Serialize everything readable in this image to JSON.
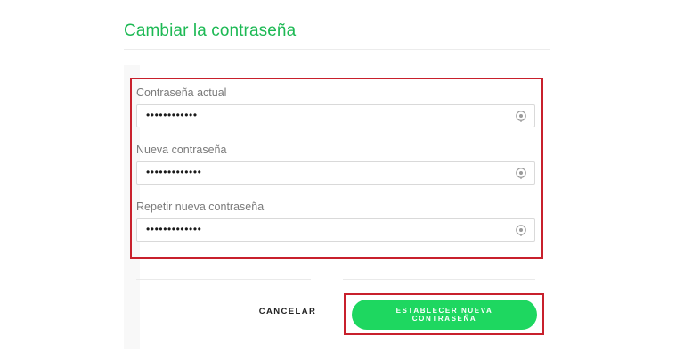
{
  "page": {
    "title": "Cambiar la contraseña"
  },
  "form": {
    "fields": [
      {
        "label": "Contraseña actual",
        "value": "••••••••••••",
        "reveal_icon": "eye-reveal-icon"
      },
      {
        "label": "Nueva contraseña",
        "value": "•••••••••••••",
        "reveal_icon": "eye-reveal-icon"
      },
      {
        "label": "Repetir nueva contraseña",
        "value": "•••••••••••••",
        "reveal_icon": "eye-reveal-icon"
      }
    ],
    "cancel_label": "CANCELAR",
    "submit_label": "ESTABLECER NUEVA CONTRASEÑA"
  },
  "colors": {
    "brand_green": "#1db954",
    "button_green": "#1ed760",
    "highlight_red": "#c8202c"
  }
}
